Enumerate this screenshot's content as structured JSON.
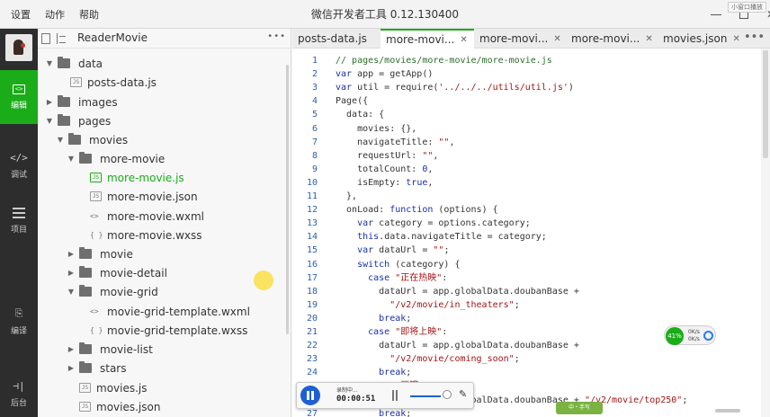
{
  "menu": [
    "设置",
    "动作",
    "帮助"
  ],
  "app_title": "微信开发者工具 0.12.130400",
  "window_badge": "小窗口播放",
  "toolbar": {
    "items": [
      {
        "label": "编辑",
        "glyph": "<>",
        "active": true
      },
      {
        "label": "调试",
        "glyph": "</>",
        "active": false
      },
      {
        "label": "项目",
        "glyph": "",
        "active": false
      },
      {
        "label": "编译",
        "glyph": "",
        "active": false
      },
      {
        "label": "后台",
        "glyph": "⊣|",
        "active": false
      }
    ]
  },
  "project": {
    "name": "ReaderMovie",
    "more": "•••"
  },
  "file_tree": [
    {
      "label": "data",
      "type": "folder",
      "expanded": true
    },
    {
      "label": "posts-data.js",
      "type": "file",
      "icon": "JS"
    },
    {
      "label": "images",
      "type": "folder",
      "expanded": false
    },
    {
      "label": "pages",
      "type": "folder",
      "expanded": true
    },
    {
      "label": "movies",
      "type": "folder",
      "expanded": true
    },
    {
      "label": "more-movie",
      "type": "folder",
      "expanded": true
    },
    {
      "label": "more-movie.js",
      "type": "file",
      "icon": "JS",
      "active": true
    },
    {
      "label": "more-movie.json",
      "type": "file",
      "icon": "JS"
    },
    {
      "label": "more-movie.wxml",
      "type": "file",
      "icon": "<>"
    },
    {
      "label": "more-movie.wxss",
      "type": "file",
      "icon": "{ }"
    },
    {
      "label": "movie",
      "type": "folder",
      "expanded": false
    },
    {
      "label": "movie-detail",
      "type": "folder",
      "expanded": false
    },
    {
      "label": "movie-grid",
      "type": "folder",
      "expanded": true
    },
    {
      "label": "movie-grid-template.wxml",
      "type": "file",
      "icon": "<>"
    },
    {
      "label": "movie-grid-template.wxss",
      "type": "file",
      "icon": "{ }"
    },
    {
      "label": "movie-list",
      "type": "folder",
      "expanded": false
    },
    {
      "label": "stars",
      "type": "folder",
      "expanded": false
    },
    {
      "label": "movies.js",
      "type": "file",
      "icon": "JS"
    },
    {
      "label": "movies.json",
      "type": "file",
      "icon": "JS"
    }
  ],
  "tabs": [
    {
      "label": "posts-data.js",
      "closable": false
    },
    {
      "label": "more-movi...",
      "closable": true,
      "active": true
    },
    {
      "label": "more-movi...",
      "closable": true
    },
    {
      "label": "more-movi...",
      "closable": true
    },
    {
      "label": "movies.json",
      "closable": true
    }
  ],
  "tabs_more": "•••",
  "code_lines": [
    {
      "n": "1",
      "tokens": [
        [
          "c",
          "// pages/movies/more-movie/more-movie.js"
        ]
      ]
    },
    {
      "n": "2",
      "tokens": [
        [
          "k",
          "var"
        ],
        [
          "p",
          " app = getApp()"
        ]
      ]
    },
    {
      "n": "3",
      "tokens": [
        [
          "k",
          "var"
        ],
        [
          "p",
          " util = require("
        ],
        [
          "s",
          "'../../../utils/util.js'"
        ],
        [
          "p",
          ")"
        ]
      ]
    },
    {
      "n": "4",
      "tokens": [
        [
          "p",
          "Page({"
        ]
      ]
    },
    {
      "n": "5",
      "tokens": [
        [
          "p",
          "  data: {"
        ]
      ]
    },
    {
      "n": "6",
      "tokens": [
        [
          "p",
          "    movies: {},"
        ]
      ]
    },
    {
      "n": "7",
      "tokens": [
        [
          "p",
          "    navigateTitle: "
        ],
        [
          "s",
          "\"\""
        ],
        [
          "p",
          ","
        ]
      ]
    },
    {
      "n": "8",
      "tokens": [
        [
          "p",
          "    requestUrl: "
        ],
        [
          "s",
          "\"\""
        ],
        [
          "p",
          ","
        ]
      ]
    },
    {
      "n": "9",
      "tokens": [
        [
          "p",
          "    totalCount: "
        ],
        [
          "k",
          "0"
        ],
        [
          "p",
          ","
        ]
      ]
    },
    {
      "n": "10",
      "tokens": [
        [
          "p",
          "    isEmpty: "
        ],
        [
          "k",
          "true"
        ],
        [
          "p",
          ","
        ]
      ]
    },
    {
      "n": "11",
      "tokens": [
        [
          "p",
          "  },"
        ]
      ]
    },
    {
      "n": "12",
      "tokens": [
        [
          "p",
          "  onLoad: "
        ],
        [
          "k",
          "function"
        ],
        [
          "p",
          " (options) {"
        ]
      ]
    },
    {
      "n": "13",
      "tokens": [
        [
          "k",
          "    var"
        ],
        [
          "p",
          " category = options.category;"
        ]
      ]
    },
    {
      "n": "14",
      "tokens": [
        [
          "k",
          "    this"
        ],
        [
          "p",
          ".data.navigateTitle = category;"
        ]
      ]
    },
    {
      "n": "15",
      "tokens": [
        [
          "k",
          "    var"
        ],
        [
          "p",
          " dataUrl = "
        ],
        [
          "s",
          "\"\""
        ],
        [
          "p",
          ";"
        ]
      ]
    },
    {
      "n": "16",
      "tokens": [
        [
          "k",
          "    switch"
        ],
        [
          "p",
          " (category) {"
        ]
      ]
    },
    {
      "n": "17",
      "tokens": [
        [
          "k",
          "      case"
        ],
        [
          "s",
          " \"正在热映\""
        ],
        [
          "p",
          ":"
        ]
      ]
    },
    {
      "n": "18",
      "tokens": [
        [
          "p",
          "        dataUrl = app.globalData.doubanBase +"
        ]
      ]
    },
    {
      "n": "19",
      "tokens": [
        [
          "s",
          "          \"/v2/movie/in_theaters\""
        ],
        [
          "p",
          ";"
        ]
      ]
    },
    {
      "n": "20",
      "tokens": [
        [
          "k",
          "        break"
        ],
        [
          "p",
          ";"
        ]
      ]
    },
    {
      "n": "21",
      "tokens": [
        [
          "k",
          "      case"
        ],
        [
          "s",
          " \"即将上映\""
        ],
        [
          "p",
          ":"
        ]
      ]
    },
    {
      "n": "22",
      "tokens": [
        [
          "p",
          "        dataUrl = app.globalData.doubanBase +"
        ]
      ]
    },
    {
      "n": "23",
      "tokens": [
        [
          "s",
          "          \"/v2/movie/coming_soon\""
        ],
        [
          "p",
          ";"
        ]
      ]
    },
    {
      "n": "24",
      "tokens": [
        [
          "k",
          "        break"
        ],
        [
          "p",
          ";"
        ]
      ]
    },
    {
      "n": "25",
      "tokens": [
        [
          "k",
          "      case"
        ],
        [
          "s",
          " \"豆瓣Top250\""
        ],
        [
          "p",
          ":"
        ]
      ]
    },
    {
      "n": "26",
      "tokens": [
        [
          "p",
          "        dataUrl = app.globalData.doubanBase + "
        ],
        [
          "s",
          "\"/v2/movie/top250\""
        ],
        [
          "p",
          ";"
        ]
      ]
    },
    {
      "n": "27",
      "tokens": [
        [
          "k",
          "        break"
        ],
        [
          "p",
          ";"
        ]
      ]
    },
    {
      "n": "28",
      "tokens": [
        [
          "p",
          "    }"
        ]
      ]
    }
  ],
  "recorder": {
    "label": "录制中...",
    "time": "00:00:51"
  },
  "net_widget": {
    "percent": "41%",
    "up": "0K/s",
    "down": "0K/s"
  },
  "footer_badge": "中・手写",
  "colors": {
    "accent": "#1aad19",
    "sidebar_bg": "#2d2d2d",
    "line_number": "#2b5fb3",
    "comment": "#2b6e2b",
    "keyword": "#1a2fa8",
    "string": "#a31515"
  }
}
